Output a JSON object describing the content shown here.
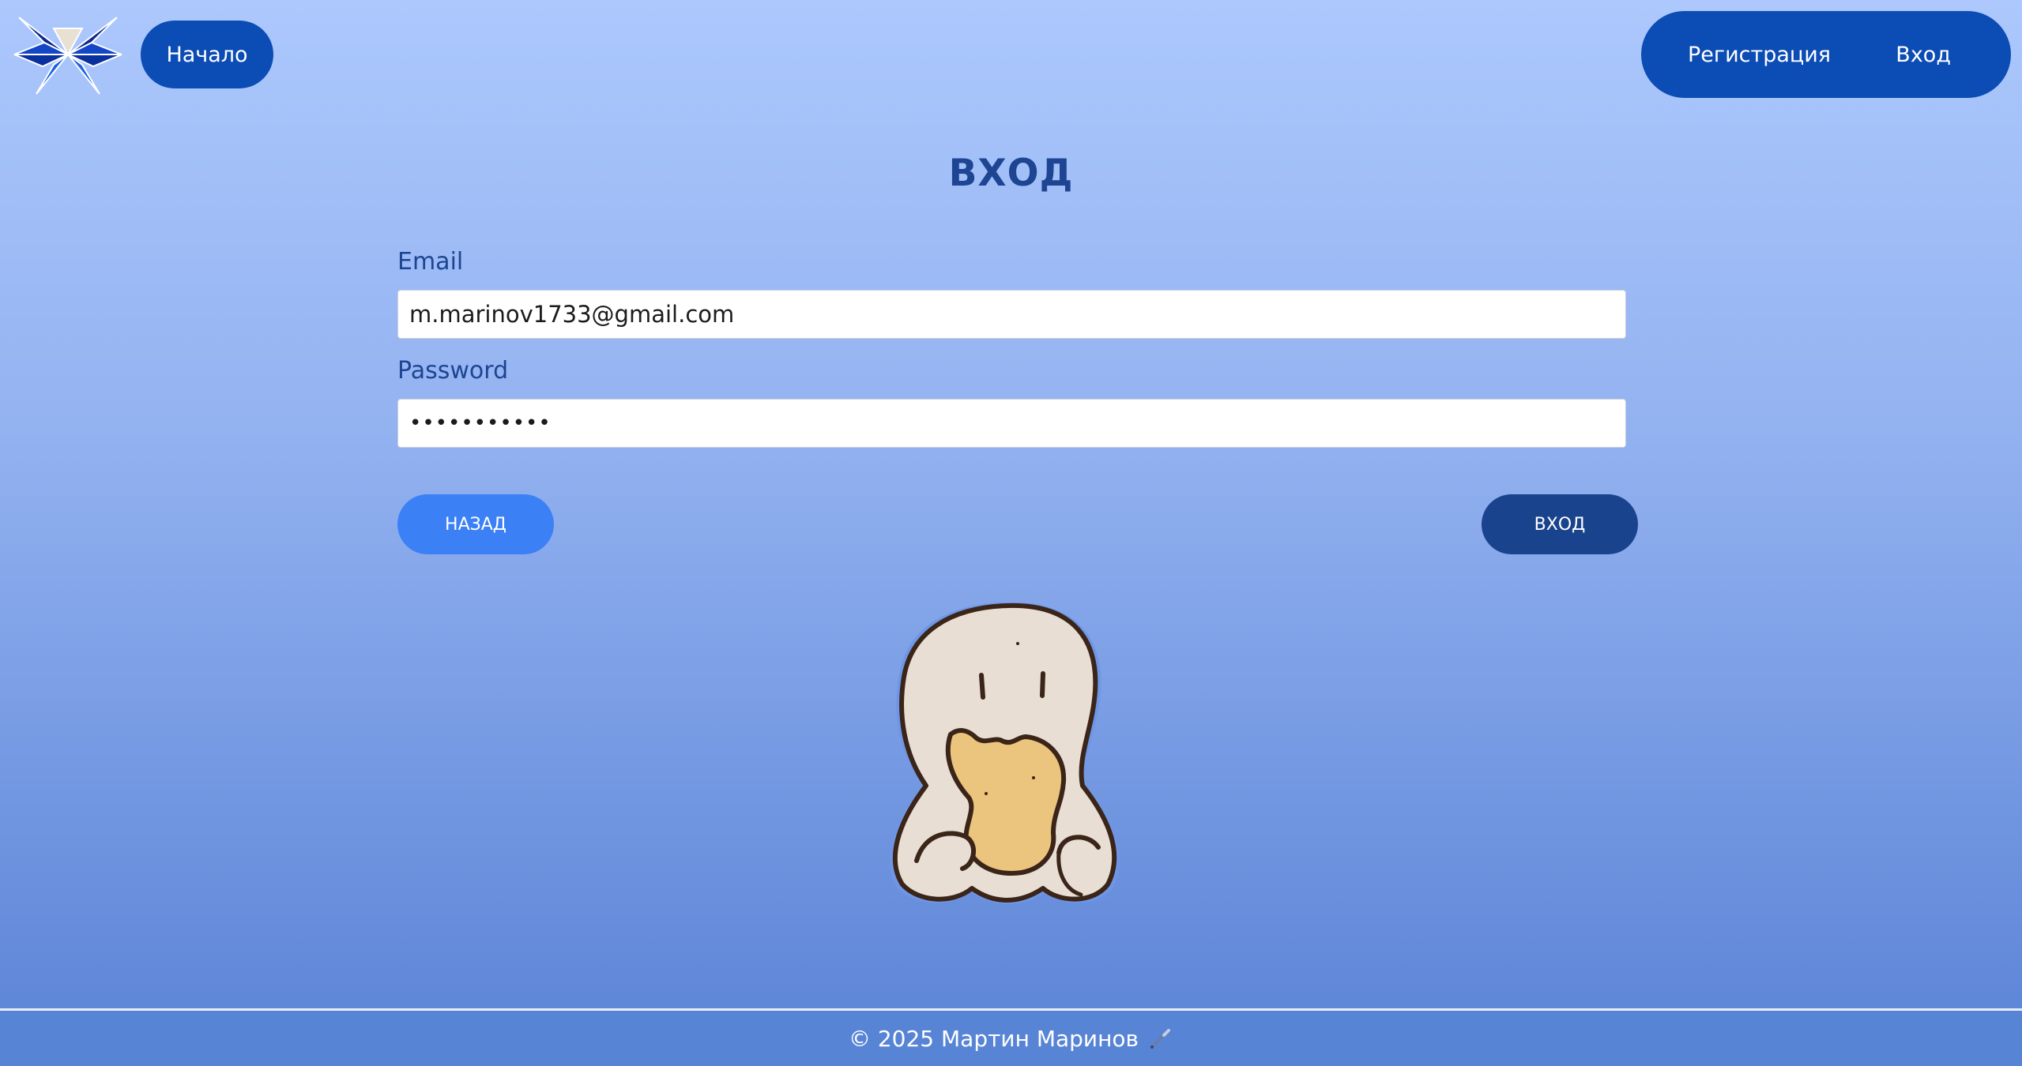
{
  "header": {
    "home_label": "Начало",
    "register_label": "Регистрация",
    "login_label": "Вход"
  },
  "form": {
    "title": "ВХОД",
    "email_label": "Email",
    "email_value": "m.marinov1733@gmail.com",
    "password_label": "Password",
    "password_value": "•••••••••••",
    "back_button": "НАЗАД",
    "submit_button": "ВХОД"
  },
  "footer": {
    "copyright": "© 2025 Мартин Маринов",
    "icon": "pen-icon"
  },
  "colors": {
    "primary": "#0c4cb5",
    "secondary_button": "#3b80f5",
    "dark_button": "#1a438d",
    "title": "#1d4592"
  }
}
